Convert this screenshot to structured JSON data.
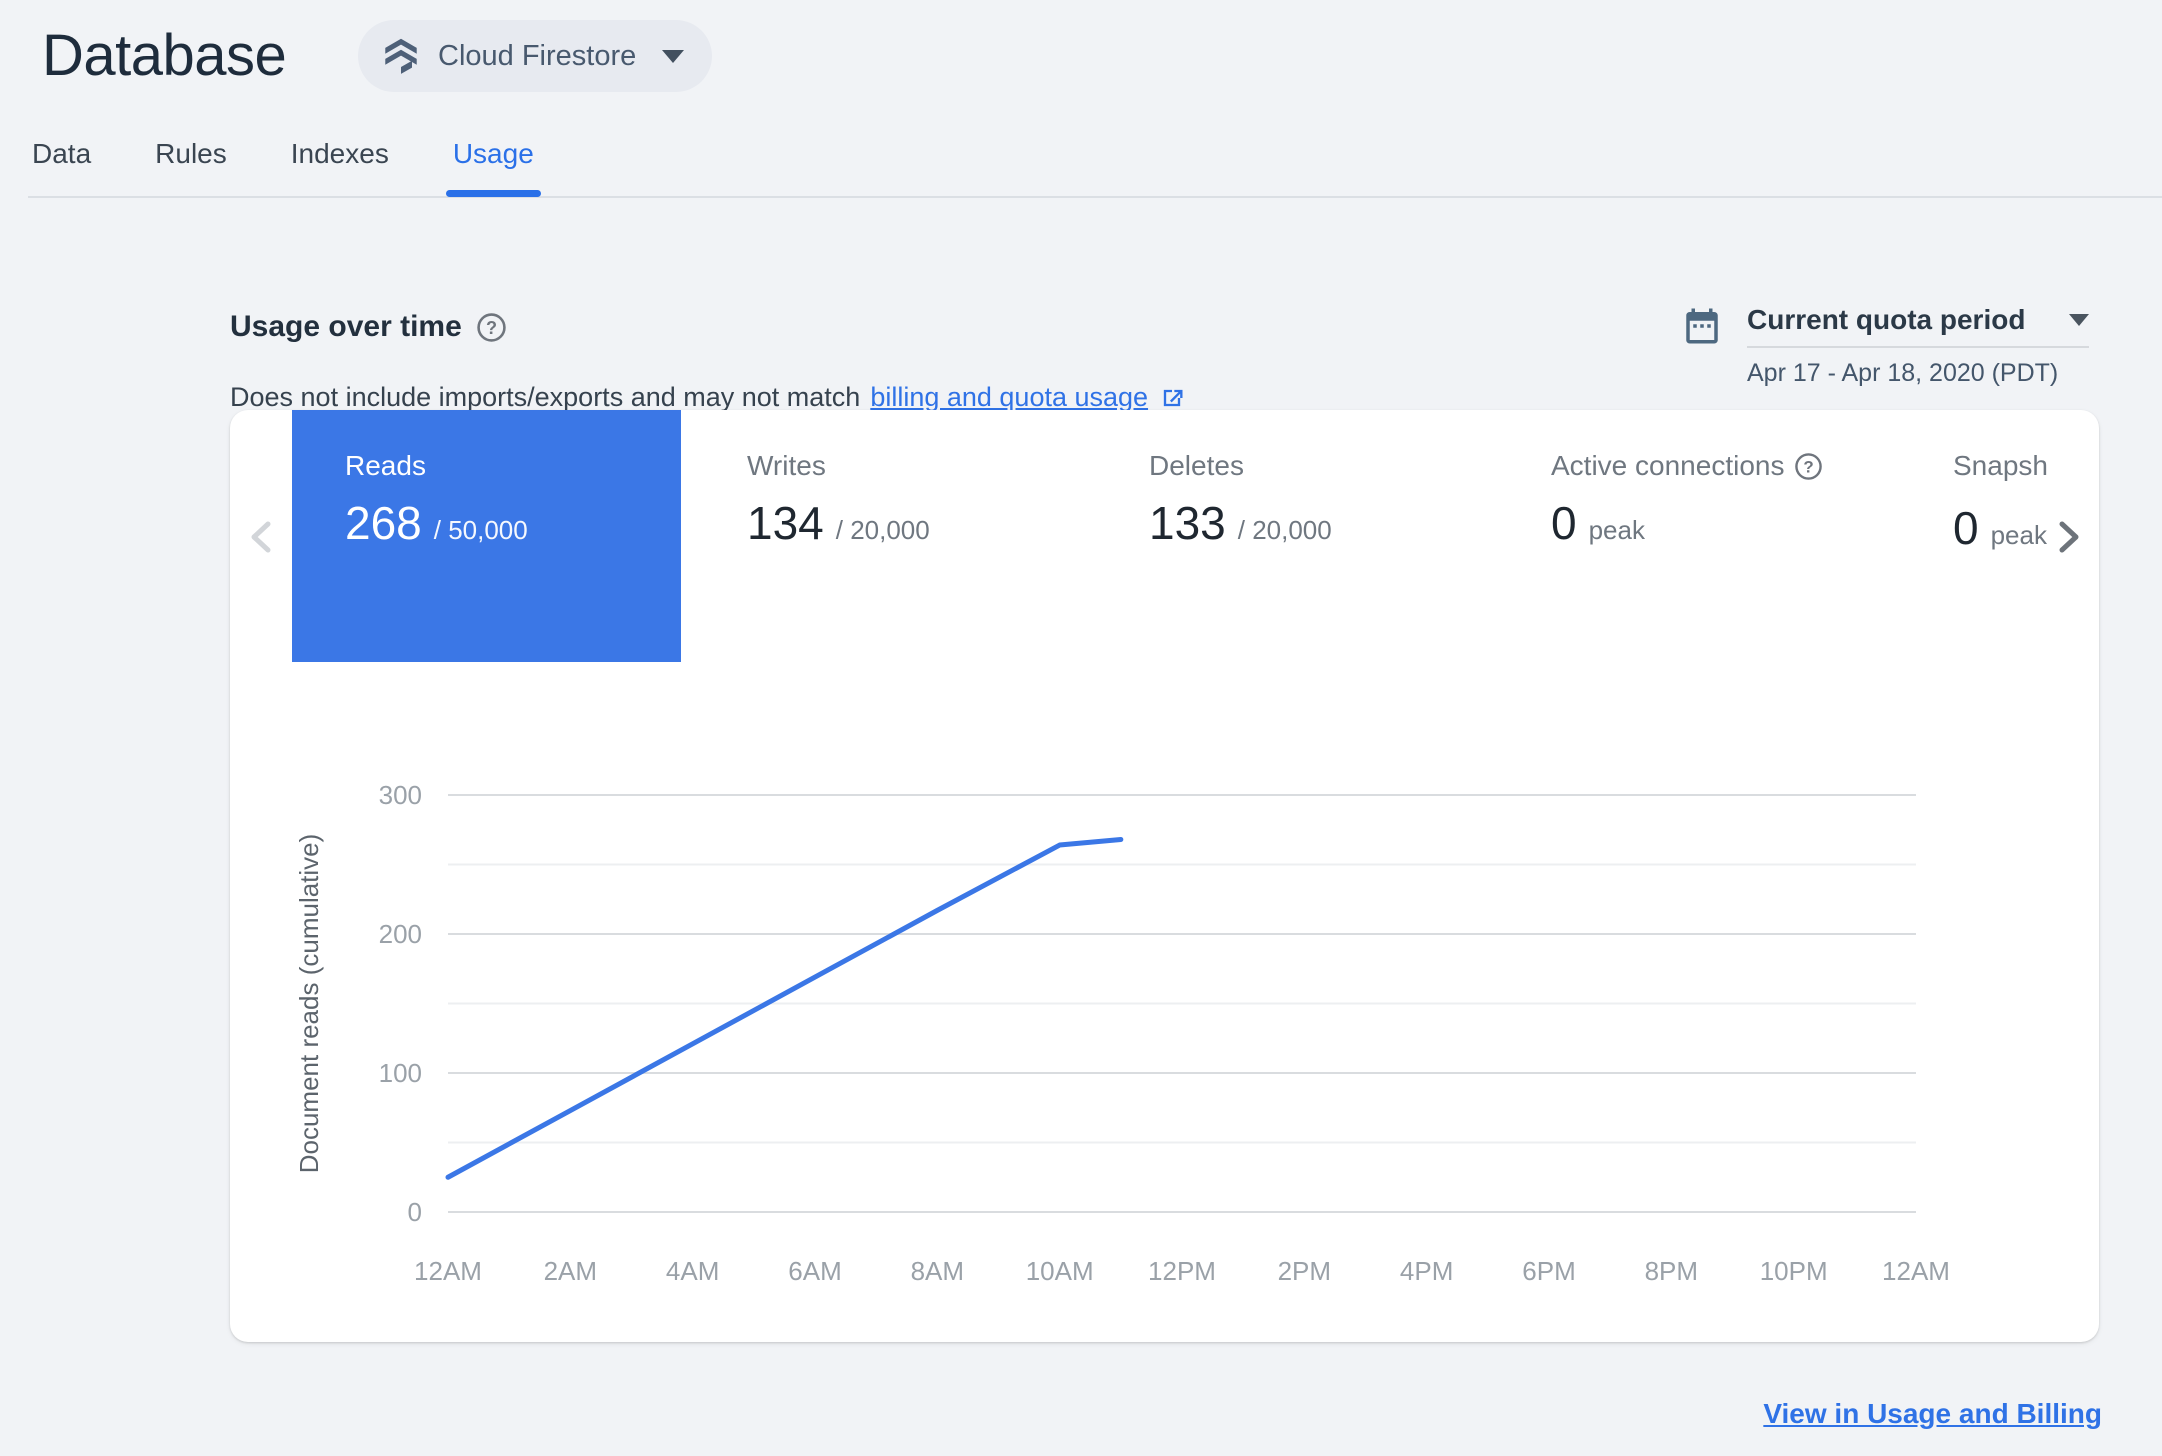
{
  "colors": {
    "page_bg": "#f1f3f6",
    "title": "#1e2c3c",
    "tab_inactive": "#3a4551",
    "tab_blue": "#2a70e8",
    "link_blue": "#2f72e6",
    "accent_blue": "#3b77e6",
    "label_gray": "#6f7780",
    "value_dark": "#1f2730",
    "grid_major": "#d9dcdf",
    "grid_minor": "#edeff1",
    "axis_label": "#9aa1a8",
    "slate_icon": "#4e6078"
  },
  "header": {
    "title": "Database",
    "product_selector_label": "Cloud Firestore"
  },
  "tabs": [
    {
      "label": "Data",
      "active": false
    },
    {
      "label": "Rules",
      "active": false
    },
    {
      "label": "Indexes",
      "active": false
    },
    {
      "label": "Usage",
      "active": true
    }
  ],
  "usage_header": {
    "title": "Usage over time",
    "subtitle_text": "Does not include imports/exports and may not match",
    "subtitle_link": "billing and quota usage",
    "period_label": "Current quota period",
    "period_range": "Apr 17 - Apr 18, 2020 (PDT)"
  },
  "cards": [
    {
      "label": "Reads",
      "value": "268",
      "suffix": "/ 50,000",
      "selected": true,
      "help": false,
      "clipped": false
    },
    {
      "label": "Writes",
      "value": "134",
      "suffix": "/ 20,000",
      "selected": false,
      "help": false,
      "clipped": false
    },
    {
      "label": "Deletes",
      "value": "133",
      "suffix": "/ 20,000",
      "selected": false,
      "help": false,
      "clipped": false
    },
    {
      "label": "Active connections",
      "value": "0",
      "suffix": "peak",
      "selected": false,
      "help": true,
      "clipped": false
    },
    {
      "label": "Snapshot",
      "value": "0",
      "suffix": "peak",
      "selected": false,
      "help": false,
      "clipped": true
    }
  ],
  "chart_data": {
    "type": "line",
    "title": "",
    "xlabel": "",
    "ylabel": "Document reads (cumulative)",
    "ylim": [
      0,
      300
    ],
    "yticks": [
      0,
      100,
      200,
      300
    ],
    "grid_step": 50,
    "grid": "horizontal",
    "legend": "none",
    "x_hours_range": [
      0,
      24
    ],
    "x_tick_labels": [
      "12AM",
      "2AM",
      "4AM",
      "6AM",
      "8AM",
      "10AM",
      "12PM",
      "2PM",
      "4PM",
      "6PM",
      "8PM",
      "10PM",
      "12AM"
    ],
    "series": [
      {
        "name": "Document reads (cumulative)",
        "color": "#3b77e6",
        "points": [
          [
            0,
            25
          ],
          [
            2,
            73
          ],
          [
            4,
            121
          ],
          [
            6,
            169
          ],
          [
            8,
            217
          ],
          [
            10,
            264
          ],
          [
            11,
            268
          ]
        ]
      }
    ]
  },
  "footer": {
    "link_label": "View in Usage and Billing"
  }
}
